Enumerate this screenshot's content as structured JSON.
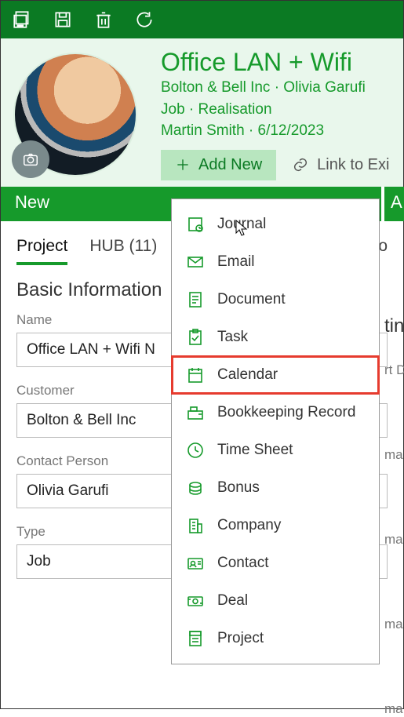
{
  "toolbar": {},
  "header": {
    "title": "Office LAN + Wifi",
    "line1": "Bolton & Bell Inc · Olivia Garufi",
    "line2": "Job · Realisation",
    "line3": "Martin Smith · 6/12/2023",
    "add_new_label": "Add New",
    "link_label": "Link to Exi"
  },
  "status": {
    "current": "New",
    "next": "A"
  },
  "tabs": {
    "project": "Project",
    "hub": "HUB (11)",
    "right": "Jo"
  },
  "section": {
    "title": "Basic Information",
    "right_title_fragment": "tin",
    "fields": {
      "name": {
        "label": "Name",
        "value": "Office LAN + Wifi N"
      },
      "customer": {
        "label": "Customer",
        "value": "Bolton & Bell Inc"
      },
      "contact": {
        "label": "Contact Person",
        "value": "Olivia Garufi"
      },
      "type": {
        "label": "Type",
        "value": "Job"
      }
    },
    "right_labels": {
      "rt_d": "rt D",
      "ma1": "ma",
      "ma2": "ma",
      "ma3": "ma",
      "ma4": "ma"
    }
  },
  "dropdown": [
    {
      "label": "Journal",
      "name": "journal"
    },
    {
      "label": "Email",
      "name": "email"
    },
    {
      "label": "Document",
      "name": "document"
    },
    {
      "label": "Task",
      "name": "task"
    },
    {
      "label": "Calendar",
      "name": "calendar",
      "highlight": true
    },
    {
      "label": "Bookkeeping Record",
      "name": "bookkeeping"
    },
    {
      "label": "Time Sheet",
      "name": "timesheet"
    },
    {
      "label": "Bonus",
      "name": "bonus"
    },
    {
      "label": "Company",
      "name": "company"
    },
    {
      "label": "Contact",
      "name": "contact"
    },
    {
      "label": "Deal",
      "name": "deal"
    },
    {
      "label": "Project",
      "name": "project"
    }
  ]
}
